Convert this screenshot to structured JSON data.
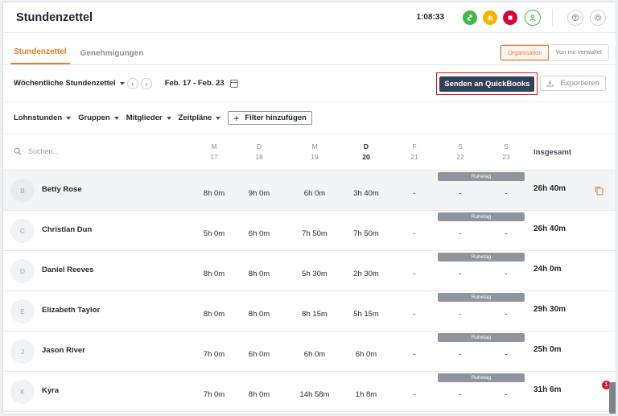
{
  "header": {
    "title": "Stundenzettel",
    "timer": "1:08:33",
    "actions": [
      {
        "name": "switch-activity-icon",
        "color": "#45b649"
      },
      {
        "name": "break-hand-icon",
        "color": "#f7b500"
      },
      {
        "name": "stop-icon",
        "color": "#d10a3a"
      },
      {
        "name": "user-status-icon",
        "color": "#45b649"
      },
      {
        "name": "help-icon"
      },
      {
        "name": "settings-icon"
      }
    ]
  },
  "tabs": [
    {
      "label": "Stundenzettel",
      "active": true
    },
    {
      "label": "Genehmigungen",
      "active": false
    }
  ],
  "scope": {
    "organisation": "Organisation",
    "managed": "Von mir verwaltet"
  },
  "toolbar": {
    "period": "Wöchentliche Stundenzettel",
    "prev": "‹",
    "next": "›",
    "date_range": "Feb. 17 - Feb. 23",
    "send_quickbooks": "Senden an QuickBooks",
    "export": "Exportieren"
  },
  "filters": {
    "pay_hours": "Lohnstunden",
    "groups": "Gruppen",
    "members": "Mitglieder",
    "schedules": "Zeitpläne",
    "add_filter": "Filter hinzufügen",
    "add_symbol": "+"
  },
  "grid": {
    "search_placeholder": "Suchen...",
    "days": [
      {
        "letter": "M",
        "date": "17"
      },
      {
        "letter": "D",
        "date": "18"
      },
      {
        "letter": "M",
        "date": "19"
      },
      {
        "letter": "D",
        "date": "20"
      },
      {
        "letter": "F",
        "date": "21"
      },
      {
        "letter": "S",
        "date": "22"
      },
      {
        "letter": "S",
        "date": "23"
      }
    ],
    "total_label": "Insgesamt",
    "rest_day_label": "Ruhetag",
    "rows": [
      {
        "initial": "B",
        "name": "Betty Rose",
        "cells": [
          "8h 0m",
          "9h 0m",
          "6h 0m",
          "3h 40m",
          "-",
          "-",
          "-"
        ],
        "total": "26h 40m"
      },
      {
        "initial": "C",
        "name": "Christian Dun",
        "cells": [
          "5h 0m",
          "6h 0m",
          "7h 50m",
          "7h 50m",
          "-",
          "-",
          "-"
        ],
        "total": "26h 40m"
      },
      {
        "initial": "D",
        "name": "Daniel Reeves",
        "cells": [
          "8h 0m",
          "8h 0m",
          "5h 30m",
          "2h 30m",
          "-",
          "-",
          "-"
        ],
        "total": "24h 0m"
      },
      {
        "initial": "E",
        "name": "Elizabeth Taylor",
        "cells": [
          "8h 0m",
          "8h 0m",
          "8h 15m",
          "5h 15m",
          "-",
          "-",
          "-"
        ],
        "total": "29h 30m"
      },
      {
        "initial": "J",
        "name": "Jason River",
        "cells": [
          "7h 0m",
          "6h 0m",
          "6h 0m",
          "6h 0m",
          "-",
          "-",
          "-"
        ],
        "total": "25h 0m"
      },
      {
        "initial": "K",
        "name": "Kyra",
        "cells": [
          "7h 0m",
          "8h 0m",
          "14h 58m",
          "1h 8m",
          "-",
          "-",
          "-"
        ],
        "total": "31h 6m"
      }
    ]
  },
  "notification_count": "1"
}
